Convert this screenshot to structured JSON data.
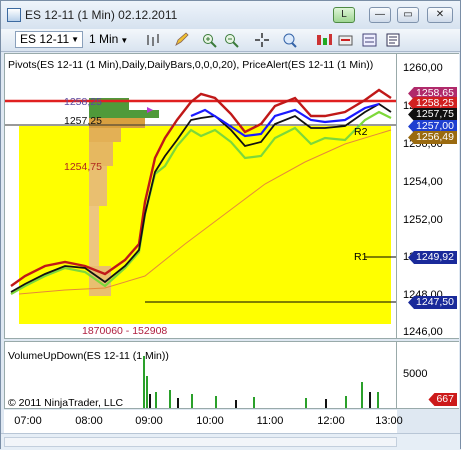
{
  "window": {
    "title": "ES 12-11 (1 Min)  02.12.2011",
    "buttons": {
      "link": "L",
      "minimize": "—",
      "restore": "▭",
      "close": "✕"
    }
  },
  "toolbar": {
    "instrument": "ES 12-11",
    "interval": "1 Min",
    "icons": [
      "bar-type-icon",
      "draw-pencil-icon",
      "zoom-in-icon",
      "zoom-out-icon",
      "crosshair-icon",
      "magnifier-icon",
      "indicators-icon",
      "strategies-icon",
      "properties-icon",
      "data-box-icon"
    ]
  },
  "price_panel": {
    "indicator_label": "Pivots(ES 12-11 (1 Min),Daily,DailyBars,0,0,0,20), PriceAlert(ES 12-11 (1 Min))",
    "y_ticks": [
      "1260,00",
      "1258,00",
      "1256,00",
      "1254,00",
      "1252,00",
      "1250,00",
      "1248,00",
      "1246,00"
    ],
    "r2_label": "R2",
    "r1_label": "R1",
    "profile_labels": {
      "top": "1258,25",
      "mid1": "1257,25",
      "mid2": "1254,75"
    },
    "volume_text": "1870060 - 152908",
    "price_tags": [
      {
        "text": "1258,65",
        "color": "#b02a6b"
      },
      {
        "text": "1258,25",
        "color": "#d02020"
      },
      {
        "text": "1257,75",
        "color": "#101010"
      },
      {
        "text": "1257,00",
        "color": "#1f3fd0"
      },
      {
        "text": "1256,49",
        "color": "#9a6a10"
      },
      {
        "text": "1249,92",
        "color": "#1a2a9a"
      },
      {
        "text": "1247,50",
        "color": "#1a2a9a"
      }
    ]
  },
  "volume_panel": {
    "label": "VolumeUpDown(ES 12-11 (1 Min))",
    "y_tick": "5000",
    "last_tag": {
      "text": "667",
      "color": "#cc1a1a"
    },
    "copyright": "© 2011 NinjaTrader, LLC"
  },
  "x_axis": {
    "ticks": [
      "07:00",
      "08:00",
      "09:00",
      "10:00",
      "11:00",
      "12:00",
      "13:00"
    ]
  },
  "colors": {
    "yellow_box": "#ffff00",
    "pivot_r1": "#000000",
    "price_line": "#d01818",
    "sma_blue": "#1a1aff"
  }
}
